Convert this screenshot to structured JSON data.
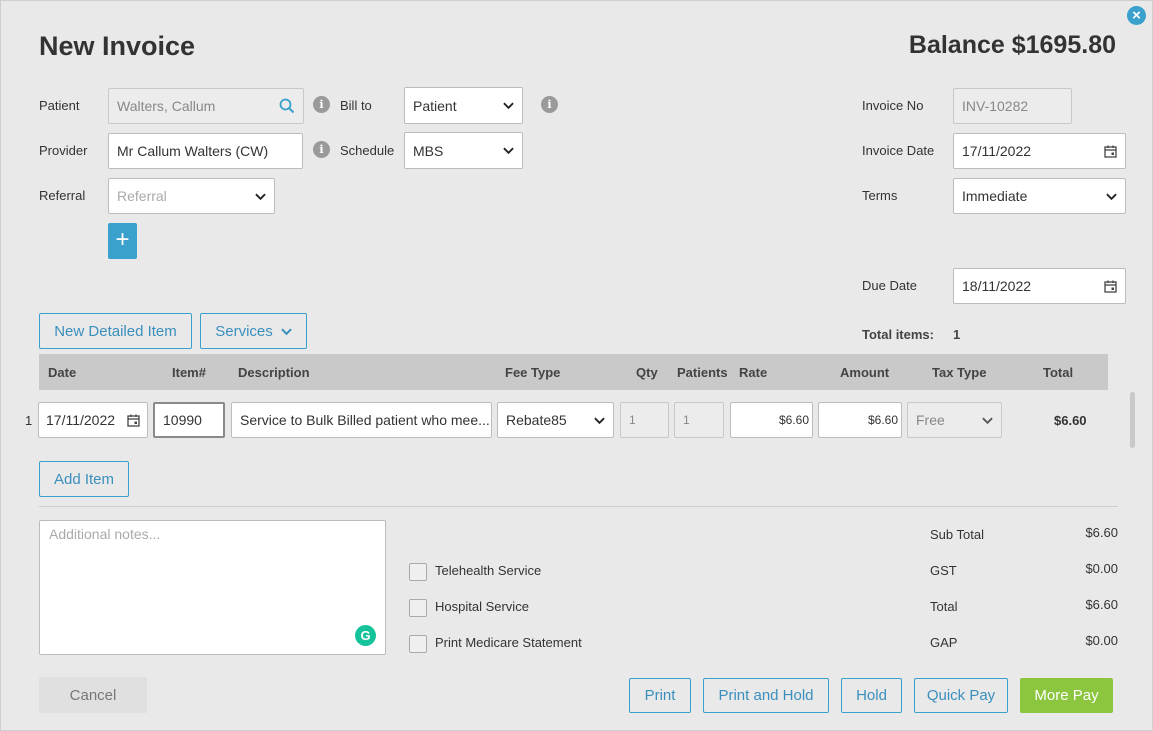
{
  "dialog": {
    "title": "New Invoice",
    "balance": "Balance $1695.80",
    "close_icon": "close-icon"
  },
  "patient": {
    "label": "Patient",
    "value": "Walters, Callum"
  },
  "bill_to": {
    "label": "Bill to",
    "value": "Patient"
  },
  "provider": {
    "label": "Provider",
    "value": "Mr Callum Walters (CW)"
  },
  "schedule": {
    "label": "Schedule",
    "value": "MBS"
  },
  "referral": {
    "label": "Referral",
    "placeholder": "Referral"
  },
  "add_referral": {
    "label": "+"
  },
  "invoice_no": {
    "label": "Invoice No",
    "value": "INV-10282"
  },
  "invoice_date": {
    "label": "Invoice Date",
    "value": "17/11/2022"
  },
  "terms": {
    "label": "Terms",
    "value": "Immediate"
  },
  "due_date": {
    "label": "Due Date",
    "value": "18/11/2022"
  },
  "toolbar": {
    "new_detailed_item": "New Detailed Item",
    "services": "Services"
  },
  "total_items": {
    "label": "Total items:",
    "value": "1"
  },
  "table": {
    "headers": {
      "date": "Date",
      "item": "Item#",
      "description": "Description",
      "fee_type": "Fee Type",
      "qty": "Qty",
      "patients": "Patients",
      "rate": "Rate",
      "amount": "Amount",
      "tax_type": "Tax Type",
      "total": "Total"
    },
    "rows": [
      {
        "index": "1",
        "date": "17/11/2022",
        "item": "10990",
        "description": "Service to Bulk Billed patient who mee...",
        "fee_type": "Rebate85",
        "qty": "1",
        "patients": "1",
        "rate": "$6.60",
        "amount": "$6.60",
        "tax_type": "Free",
        "total": "$6.60"
      }
    ]
  },
  "add_item": "Add Item",
  "notes": {
    "placeholder": "Additional notes..."
  },
  "checkboxes": [
    {
      "label": "Telehealth Service"
    },
    {
      "label": "Hospital Service"
    },
    {
      "label": "Print Medicare Statement"
    }
  ],
  "summary": [
    {
      "label": "Sub Total",
      "value": "$6.60"
    },
    {
      "label": "GST",
      "value": "$0.00"
    },
    {
      "label": "Total",
      "value": "$6.60"
    },
    {
      "label": "GAP",
      "value": "$0.00"
    }
  ],
  "footer": {
    "cancel": "Cancel",
    "print": "Print",
    "print_and_hold": "Print and Hold",
    "hold": "Hold",
    "quick_pay": "Quick Pay",
    "more_pay": "More Pay"
  },
  "colors": {
    "accent": "#3aa0cc",
    "success": "#8cc63f",
    "background": "#e9e9e9"
  }
}
